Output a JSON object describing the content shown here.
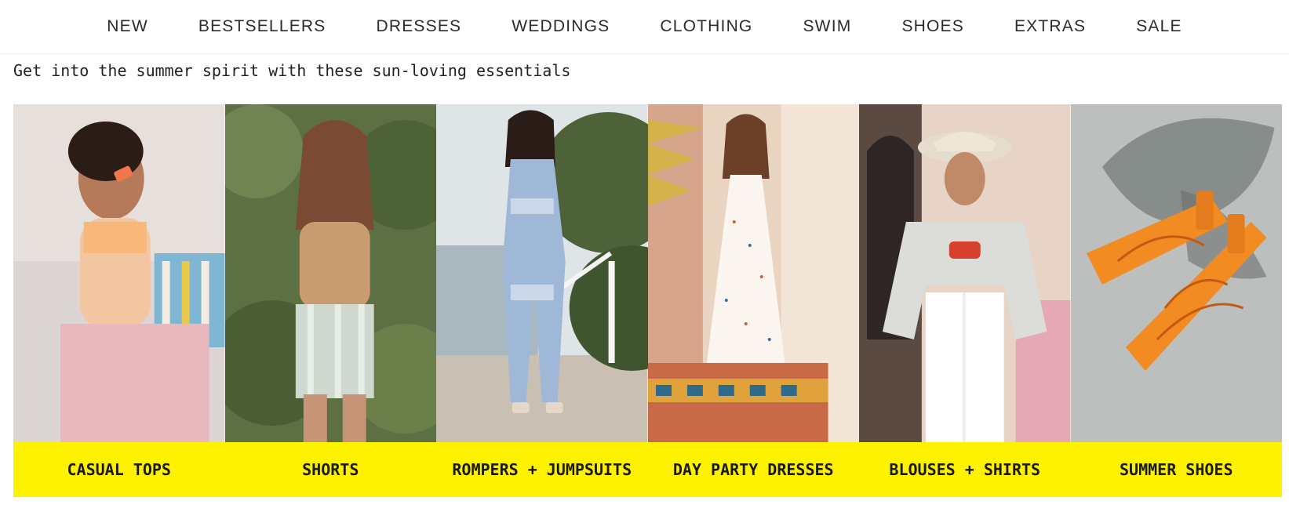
{
  "nav": {
    "items": [
      "NEW",
      "BESTSELLERS",
      "DRESSES",
      "WEDDINGS",
      "CLOTHING",
      "SWIM",
      "SHOES",
      "EXTRAS",
      "SALE"
    ]
  },
  "subtitle": "Get into the summer spirit with these sun-loving essentials",
  "categories": [
    {
      "label": "CASUAL TOPS"
    },
    {
      "label": "SHORTS"
    },
    {
      "label": "ROMPERS + JUMPSUITS"
    },
    {
      "label": "DAY PARTY DRESSES"
    },
    {
      "label": "BLOUSES + SHIRTS"
    },
    {
      "label": "SUMMER SHOES"
    }
  ],
  "colors": {
    "accent": "#fff200",
    "text": "#222222"
  }
}
